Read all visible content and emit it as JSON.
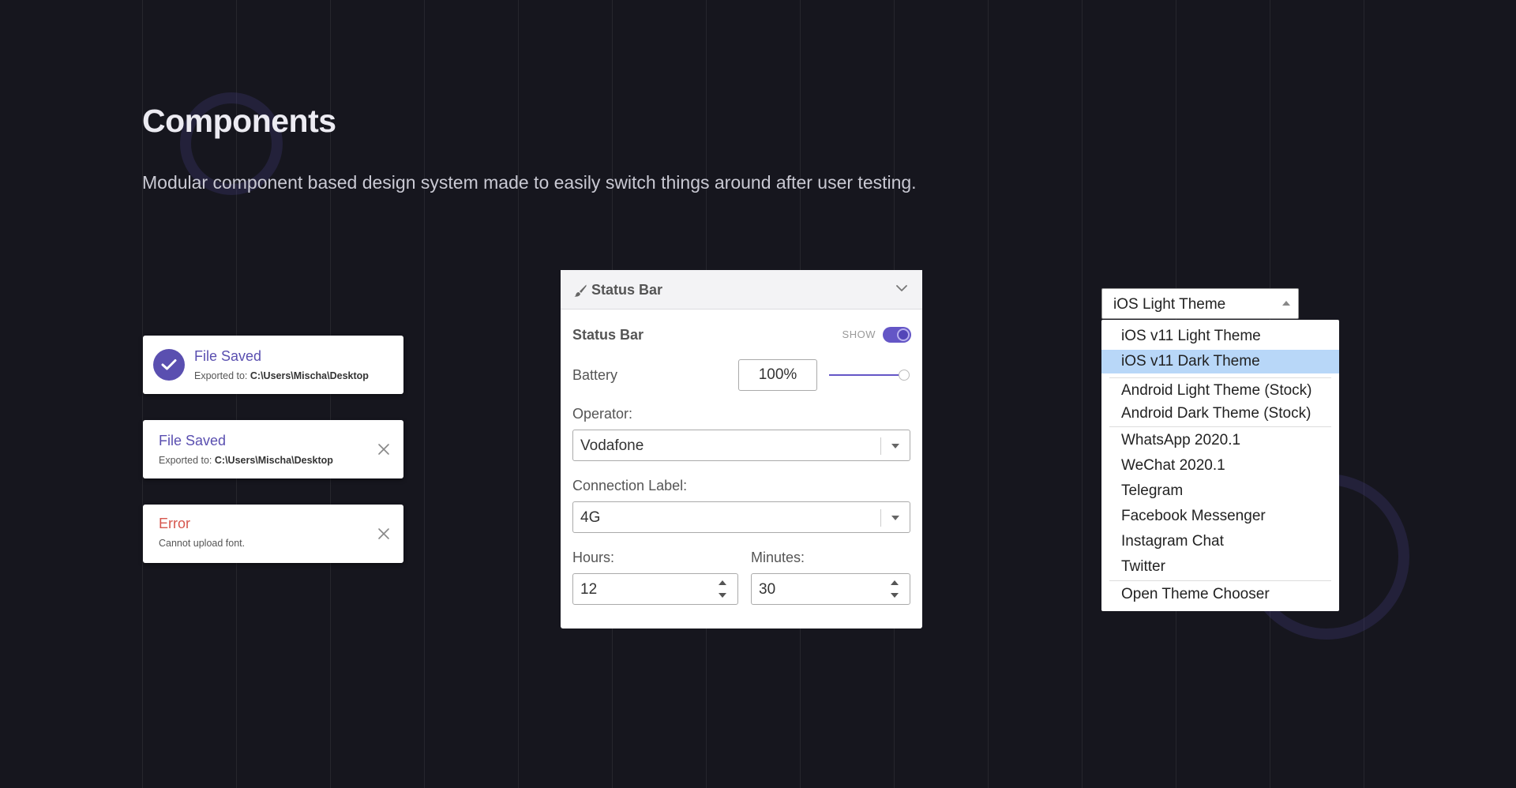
{
  "heading": {
    "title": "Components",
    "subtitle": "Modular component based design system made to easily switch things around after user testing."
  },
  "colors": {
    "background": "#16161e",
    "accent": "#5a4fb0",
    "error": "#d6564d",
    "selected": "#b8d7f8"
  },
  "toasts": [
    {
      "title": "File Saved",
      "sub_prefix": "Exported to: ",
      "sub_path": "C:\\Users\\Mischa\\Desktop",
      "icon": "check-circle-icon"
    },
    {
      "title": "File Saved",
      "sub_prefix": "Exported to: ",
      "sub_path": "C:\\Users\\Mischa\\Desktop",
      "icon": "close-icon"
    },
    {
      "title": "Error",
      "sub": "Cannot upload font.",
      "icon": "close-icon"
    }
  ],
  "panel": {
    "title": "Status Bar",
    "status_label": "Status Bar",
    "show_label": "SHOW",
    "show_on": true,
    "battery_label": "Battery",
    "battery_value": "100%",
    "battery_level": 100,
    "operator_label": "Operator:",
    "operator_value": "Vodafone",
    "connection_label": "Connection Label:",
    "connection_value": "4G",
    "hours_label": "Hours:",
    "hours_value": "12",
    "minutes_label": "Minutes:",
    "minutes_value": "30"
  },
  "theme_select": {
    "value": "iOS Light Theme",
    "items": [
      {
        "label": "iOS v11 Light Theme"
      },
      {
        "label": "iOS v11 Dark Theme",
        "selected": true
      },
      {
        "label": "Android Light Theme (Stock)"
      },
      {
        "label": "Android Dark Theme (Stock)"
      },
      {
        "label": "WhatsApp 2020.1"
      },
      {
        "label": "WeChat 2020.1"
      },
      {
        "label": "Telegram"
      },
      {
        "label": "Facebook Messenger"
      },
      {
        "label": "Instagram Chat"
      },
      {
        "label": "Twitter"
      },
      {
        "label": "Open Theme Chooser"
      }
    ]
  }
}
